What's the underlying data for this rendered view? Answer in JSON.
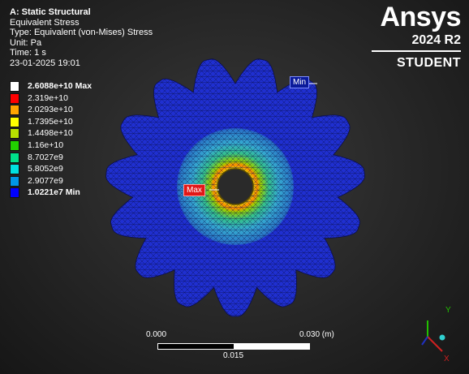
{
  "analysis": {
    "title": "A: Static Structural",
    "result": "Equivalent Stress",
    "type": "Type: Equivalent (von-Mises) Stress",
    "unit": "Unit: Pa",
    "time": "Time: 1 s",
    "timestamp": "23-01-2025 19:01"
  },
  "branding": {
    "name": "Ansys",
    "version": "2024 R2",
    "edition": "STUDENT"
  },
  "legend": {
    "entries": [
      {
        "label": "2.6088e+10 Max",
        "color": "#ffffff",
        "bold": true
      },
      {
        "label": "2.319e+10",
        "color": "#ff0000"
      },
      {
        "label": "2.0293e+10",
        "color": "#ffa500"
      },
      {
        "label": "1.7395e+10",
        "color": "#ffff00"
      },
      {
        "label": "1.4498e+10",
        "color": "#b7e000"
      },
      {
        "label": "1.16e+10",
        "color": "#22d000"
      },
      {
        "label": "8.7027e9",
        "color": "#00e08a"
      },
      {
        "label": "5.8052e9",
        "color": "#00e0e0"
      },
      {
        "label": "2.9077e9",
        "color": "#0096e6"
      },
      {
        "label": "1.0221e7 Min",
        "color": "#0000ff",
        "bold": true
      }
    ]
  },
  "probes": {
    "min_label": "Min",
    "max_label": "Max"
  },
  "scale": {
    "start": "0.000",
    "end": "0.030 (m)",
    "mid": "0.015"
  },
  "triad": {
    "x_label": "X",
    "y_label": "Y"
  },
  "colors": {
    "mesh_low": "#1f2fd0",
    "mesh_mid": "#3aa0c8",
    "mesh_high": "#e2d000"
  }
}
